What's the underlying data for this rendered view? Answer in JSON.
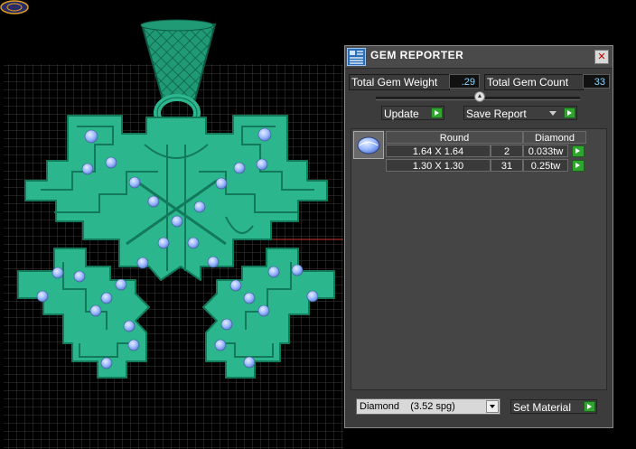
{
  "panel": {
    "title": "GEM REPORTER",
    "close_glyph": "✕",
    "total_gem_weight_label": "Total Gem Weight",
    "total_gem_weight_value": ".29",
    "total_gem_count_label": "Total Gem Count",
    "total_gem_count_value": "33",
    "update_label": "Update",
    "save_report_label": "Save Report",
    "table": {
      "headers": [
        "Round",
        "Diamond"
      ],
      "rows": [
        {
          "size": "1.64 X 1.64",
          "count": "2",
          "weight": "0.033tw"
        },
        {
          "size": "1.30 X 1.30",
          "count": "31",
          "weight": "0.25tw"
        }
      ]
    },
    "material_select_value": "Diamond    (3.52 spg)",
    "set_material_label": "Set Material"
  },
  "icons": {
    "title": "gem-reporter-icon",
    "close": "close-icon",
    "gem": "round-gem-icon",
    "corner": "app-logo-icon"
  },
  "colors": {
    "model_green": "#2bb68e",
    "gem_blue": "#9ab8ff",
    "grid_line": "#3a3a3a",
    "accent_green_button": "#2fa52f",
    "value_text": "#8ed6ff"
  }
}
